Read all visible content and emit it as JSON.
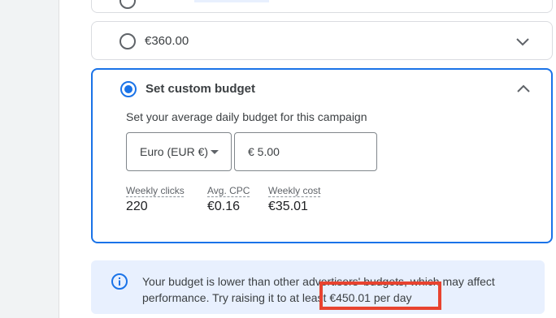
{
  "options": {
    "budget_360": {
      "label": "€360.00",
      "icon": "chevron-down-icon"
    }
  },
  "custom": {
    "label": "Set custom budget",
    "collapse_icon": "chevron-up-icon",
    "helper": "Set your average daily budget for this campaign",
    "currency": "Euro (EUR €)",
    "amount": "€ 5.00",
    "metrics": [
      {
        "label": "Weekly clicks",
        "value": "220"
      },
      {
        "label": "Avg. CPC",
        "value": "€0.16"
      },
      {
        "label": "Weekly cost",
        "value": "€35.01"
      }
    ]
  },
  "notice": {
    "icon": "info-icon",
    "line1": "Your budget is lower than other advertisers' budgets, which may affect",
    "line2": "performance. Try raising it to at least €450.01 per day"
  },
  "colors": {
    "accent": "#1a73e8",
    "notice_bg": "#e8f0fe",
    "highlight": "#e8432f"
  }
}
